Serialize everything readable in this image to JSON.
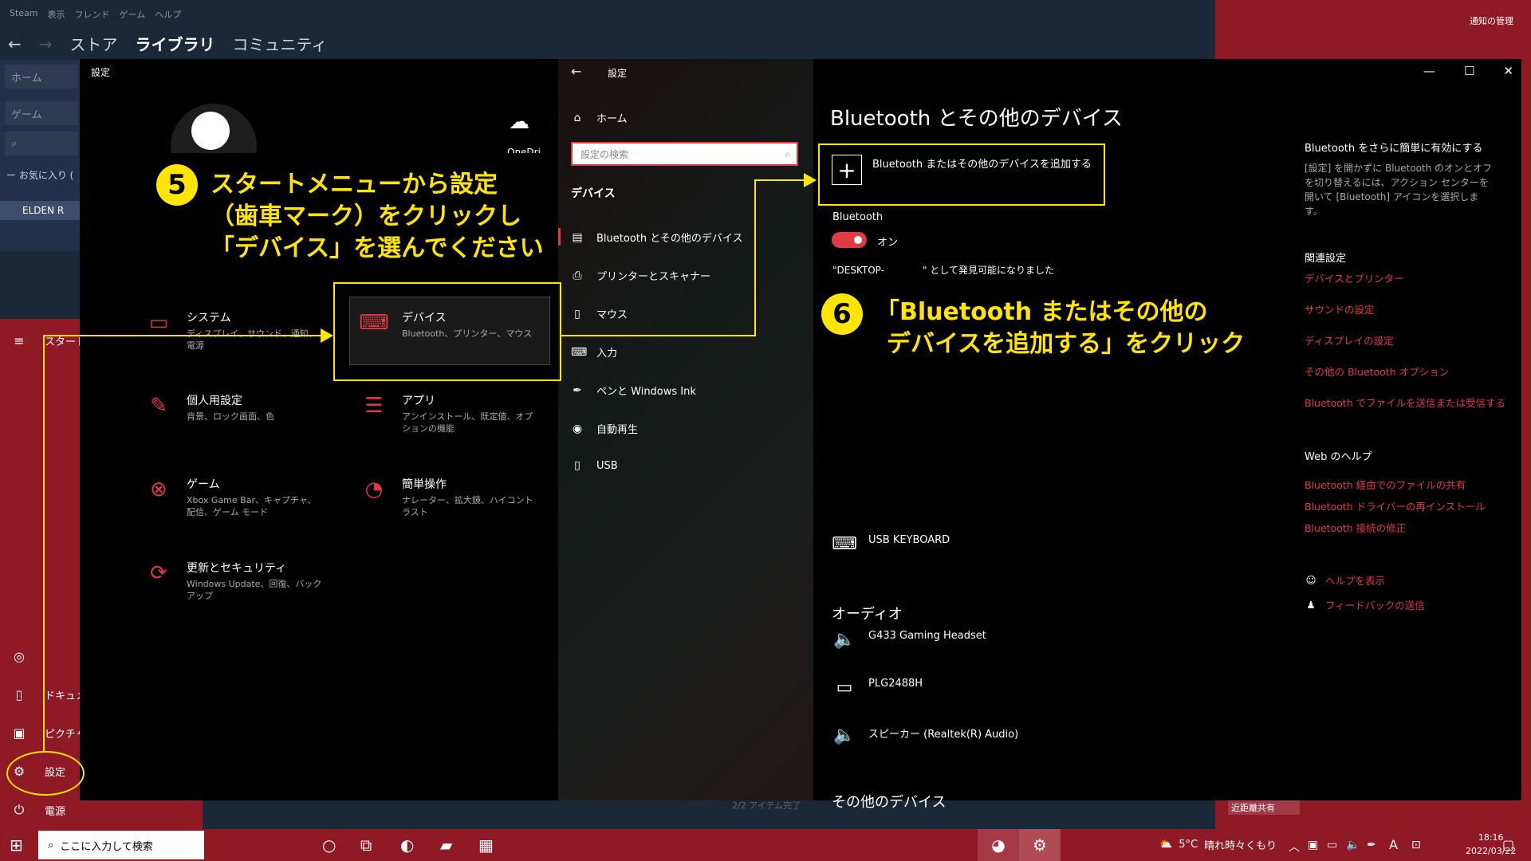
{
  "steam": {
    "menu": [
      "Steam",
      "表示",
      "フレンド",
      "ゲーム",
      "ヘルプ"
    ],
    "nav": {
      "store": "ストア",
      "library": "ライブラリ",
      "community": "コミュニティ"
    },
    "side": {
      "home": "ホーム",
      "games": "ゲーム",
      "favorites": "ー お気に入り (",
      "game": "ELDEN R"
    },
    "status": "2/2 アイテム完了",
    "notify_manage": "通知の管理",
    "near_share": "近距離共有"
  },
  "start_menu": {
    "start": "スタート",
    "documents": "ドキュメン",
    "pictures": "ピクチャ",
    "settings": "設定",
    "power": "電源"
  },
  "settings_home": {
    "title": "設定",
    "onedrive": "OneDri",
    "categories": [
      {
        "title": "システム",
        "sub": "ディスプレイ、サウンド、通知、電源",
        "icon": "laptop-icon"
      },
      {
        "title": "デバイス",
        "sub": "Bluetooth、プリンター、マウス",
        "icon": "keyboard-speaker-icon"
      },
      {
        "title": "個人用設定",
        "sub": "背景、ロック画面、色",
        "icon": "paint-icon"
      },
      {
        "title": "アプリ",
        "sub": "アンインストール、既定値、オプションの機能",
        "icon": "apps-list-icon"
      },
      {
        "title": "ゲーム",
        "sub": "Xbox Game Bar、キャプチャ、配信、ゲーム モード",
        "icon": "xbox-icon"
      },
      {
        "title": "簡単操作",
        "sub": "ナレーター、拡大鏡、ハイコントラスト",
        "icon": "ease-of-access-icon"
      },
      {
        "title": "更新とセキュリティ",
        "sub": "Windows Update、回復、バックアップ",
        "icon": "update-icon"
      }
    ]
  },
  "devices_nav": {
    "title": "設定",
    "home": "ホーム",
    "search_placeholder": "設定の検索",
    "section": "デバイス",
    "items": [
      "Bluetooth とその他のデバイス",
      "プリンターとスキャナー",
      "マウス",
      "入力",
      "ペンと Windows Ink",
      "自動再生",
      "USB"
    ]
  },
  "bluetooth_page": {
    "title": "Bluetooth とその他のデバイス",
    "add_device": "Bluetooth またはその他のデバイスを追加する",
    "bluetooth_label": "Bluetooth",
    "toggle_state": "オン",
    "discoverable": "\"DESKTOP-　　　　\" として発見可能になりました",
    "keyboard": "USB KEYBOARD",
    "audio_header": "オーディオ",
    "audio_devices": [
      "G433 Gaming Headset",
      "PLG2488H",
      "スピーカー (Realtek(R) Audio)"
    ],
    "other_header": "その他のデバイス"
  },
  "right_column": {
    "easy_header": "Bluetooth をさらに簡単に有効にする",
    "easy_text": "[設定] を開かずに Bluetooth のオンとオフを切り替えるには、アクション センターを開いて [Bluetooth] アイコンを選択します。",
    "related_header": "関連設定",
    "related_links": [
      "デバイスとプリンター",
      "サウンドの設定",
      "ディスプレイの設定",
      "その他の Bluetooth オプション",
      "Bluetooth でファイルを送信または受信する"
    ],
    "web_header": "Web のヘルプ",
    "web_links": [
      "Bluetooth 経由でのファイルの共有",
      "Bluetooth ドライバーの再インストール",
      "Bluetooth 接続の修正"
    ],
    "help": "ヘルプを表示",
    "feedback": "フィードバックの送信"
  },
  "annotations": {
    "step5_num": "5",
    "step5_lines": [
      "スタートメニューから設定",
      "（歯車マーク）をクリックし",
      "「デバイス」を選んでください"
    ],
    "step6_num": "6",
    "step6_lines": [
      "「Bluetooth またはその他の",
      "デバイスを追加する」をクリック"
    ]
  },
  "taskbar": {
    "search": "ここに入力して検索",
    "temp": "5°C",
    "weather": "晴れ時々くもり",
    "ime": "A",
    "time": "18:16",
    "date": "2022/03/22"
  },
  "colors": {
    "accent": "#e03a44",
    "annotation": "#ffe500",
    "taskbar": "#8f1a26"
  }
}
